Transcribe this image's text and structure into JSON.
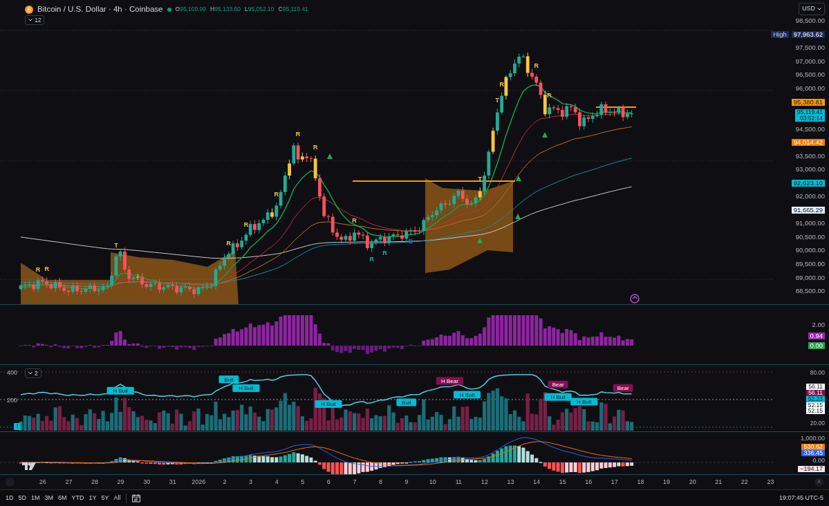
{
  "header": {
    "title": "Bitcoin / U.S. Dollar · 4h · Coinbase",
    "ohlc": [
      {
        "label": "O",
        "value": "95,109.99"
      },
      {
        "label": "H",
        "value": "95,133.60"
      },
      {
        "label": "L",
        "value": "95,052.10"
      },
      {
        "label": "C",
        "value": "95,119.41"
      }
    ],
    "indicator_toggle": "12"
  },
  "currency": "USD",
  "price_axis": [
    {
      "kind": "tick",
      "text": "98,500.00"
    },
    {
      "kind": "high",
      "label": "High",
      "text": "97,963.62"
    },
    {
      "kind": "tick",
      "text": "97,500.00"
    },
    {
      "kind": "tick",
      "text": "97,000.00"
    },
    {
      "kind": "tick",
      "text": "96,500.00"
    },
    {
      "kind": "tick",
      "text": "96,000.00"
    },
    {
      "kind": "tag",
      "text": "95,380.81",
      "color": "#ff9800"
    },
    {
      "kind": "tag",
      "text": "95,119.41",
      "countdown": "03:52:14",
      "color": "#00bcd4"
    },
    {
      "kind": "tick",
      "text": "94,500.00"
    },
    {
      "kind": "tag",
      "text": "94,014.42",
      "color": "#f57c00"
    },
    {
      "kind": "tick",
      "text": "93,500.00"
    },
    {
      "kind": "tick",
      "text": "93,000.00"
    },
    {
      "kind": "tag",
      "text": "92,623.10",
      "color": "#00bcd4"
    },
    {
      "kind": "tick",
      "text": "92,000.00"
    },
    {
      "kind": "tag",
      "text": "91,665.29",
      "color": "#e3f2fd"
    },
    {
      "kind": "tick",
      "text": "91,000.00"
    },
    {
      "kind": "tick",
      "text": "90,500.00"
    },
    {
      "kind": "tick",
      "text": "90,000.00"
    },
    {
      "kind": "tick",
      "text": "89,500.00"
    },
    {
      "kind": "tick",
      "text": "89,000.00"
    },
    {
      "kind": "tick",
      "text": "88,500.00"
    }
  ],
  "markers": [
    {
      "text": "R",
      "kind": "above",
      "color": "#f5c542"
    },
    {
      "text": "R",
      "kind": "above",
      "color": "#f5c542"
    },
    {
      "text": "T",
      "kind": "above",
      "color": "#f5c542"
    },
    {
      "text": "R",
      "kind": "above",
      "color": "#f5c542"
    },
    {
      "text": "R",
      "kind": "above",
      "color": "#f5c542"
    },
    {
      "text": "R",
      "kind": "above",
      "color": "#f5c542"
    },
    {
      "text": "R",
      "kind": "above",
      "color": "#f5c542"
    },
    {
      "text": "R",
      "kind": "above",
      "color": "#f5c542"
    },
    {
      "text": "R",
      "kind": "above",
      "color": "#f5c542"
    },
    {
      "text": "R",
      "kind": "below",
      "color": "#26a69a"
    },
    {
      "text": "R",
      "kind": "below",
      "color": "#26a69a"
    },
    {
      "text": "B",
      "kind": "below",
      "color": "#2962ff"
    },
    {
      "text": "T",
      "kind": "above",
      "color": "#f5c542"
    },
    {
      "text": "T",
      "kind": "above",
      "color": "#f5c542"
    },
    {
      "text": "R",
      "kind": "above",
      "color": "#f5c542"
    },
    {
      "text": "R",
      "kind": "above",
      "color": "#f5c542"
    },
    {
      "text": "R",
      "kind": "above",
      "color": "#f5c542"
    }
  ],
  "oscillator_panel": {
    "axis": [
      {
        "kind": "tick",
        "text": "2.00"
      },
      {
        "kind": "tag",
        "text": "0.94",
        "color": "#9c27b0"
      },
      {
        "kind": "tag",
        "text": "0.00",
        "color": "#2e9e4f"
      }
    ]
  },
  "signal_panel": {
    "toggle": "2",
    "left_ticks": [
      "400",
      "200"
    ],
    "badge": "1",
    "labels": [
      {
        "text": "H Bull",
        "kind": "below",
        "color": "#00bcd4"
      },
      {
        "text": "Bull",
        "kind": "above",
        "color": "#00bcd4"
      },
      {
        "text": "H Bull",
        "kind": "below",
        "color": "#00bcd4"
      },
      {
        "text": "H Bull",
        "kind": "below",
        "color": "#00bcd4"
      },
      {
        "text": "Bull",
        "kind": "below",
        "color": "#00bcd4"
      },
      {
        "text": "H Bear",
        "kind": "above",
        "color": "#880e4f"
      },
      {
        "text": "H Bull",
        "kind": "below",
        "color": "#00bcd4"
      },
      {
        "text": "Bear",
        "kind": "above",
        "color": "#880e4f"
      },
      {
        "text": "H Bull",
        "kind": "below",
        "color": "#00bcd4"
      },
      {
        "text": "H Bull",
        "kind": "below",
        "color": "#00bcd4"
      },
      {
        "text": "Bear",
        "kind": "above",
        "color": "#880e4f"
      }
    ],
    "axis": [
      {
        "kind": "tick",
        "text": "80.00"
      },
      {
        "kind": "tag",
        "text": "56.11",
        "color": "#ffffff"
      },
      {
        "kind": "tag",
        "text": "56.11",
        "color": "#880e4f"
      },
      {
        "kind": "tag",
        "text": "52.23",
        "color": "#00bcd4"
      },
      {
        "kind": "tag",
        "text": "52.15",
        "color": "#ffffff"
      },
      {
        "kind": "tag",
        "text": "52.15",
        "color": "#ffffff"
      },
      {
        "kind": "tick",
        "text": "20.00"
      }
    ]
  },
  "macd_panel": {
    "axis": [
      {
        "kind": "tick",
        "text": "1,000.00"
      },
      {
        "kind": "tag",
        "text": "530.62",
        "color": "#f57c00"
      },
      {
        "kind": "tag",
        "text": "336.45",
        "color": "#2962ff"
      },
      {
        "kind": "tick",
        "text": "0.00"
      },
      {
        "kind": "tag",
        "text": "−194.17",
        "color": "#fce4ec"
      }
    ]
  },
  "time_axis": [
    "26",
    "27",
    "28",
    "29",
    "30",
    "31",
    "2026",
    "2",
    "3",
    "4",
    "5",
    "6",
    "7",
    "8",
    "9",
    "10",
    "11",
    "12",
    "13",
    "14",
    "15",
    "16",
    "17",
    "18",
    "19",
    "20",
    "21",
    "22",
    "23"
  ],
  "auto_scale": "A",
  "ranges": [
    "1D",
    "5D",
    "1M",
    "3M",
    "6M",
    "YTD",
    "1Y",
    "5Y",
    "All"
  ],
  "clock": "19:07:45 UTC-5"
}
